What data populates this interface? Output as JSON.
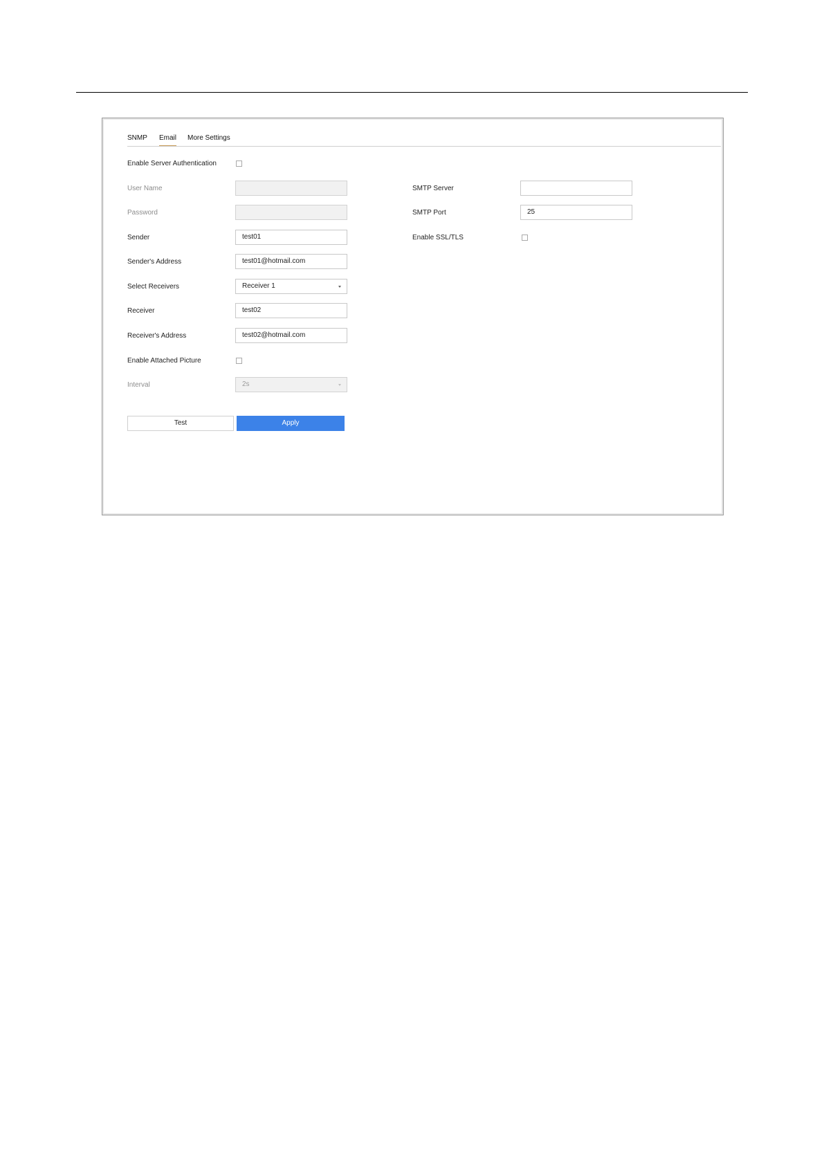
{
  "tabs": [
    {
      "label": "SNMP",
      "active": false
    },
    {
      "label": "Email",
      "active": true
    },
    {
      "label": "More Settings",
      "active": false
    }
  ],
  "form": {
    "enable_server_auth": {
      "label": "Enable Server Authentication",
      "checked": false
    },
    "user_name": {
      "label": "User Name",
      "value": "",
      "disabled": true
    },
    "password": {
      "label": "Password",
      "value": "",
      "disabled": true
    },
    "sender": {
      "label": "Sender",
      "value": "test01"
    },
    "sender_address": {
      "label": "Sender's Address",
      "value": "test01@hotmail.com"
    },
    "select_receivers": {
      "label": "Select Receivers",
      "value": "Receiver 1"
    },
    "receiver": {
      "label": "Receiver",
      "value": "test02"
    },
    "receiver_address": {
      "label": "Receiver's Address",
      "value": "test02@hotmail.com"
    },
    "enable_attached_picture": {
      "label": "Enable Attached Picture",
      "checked": false
    },
    "interval": {
      "label": "Interval",
      "value": "2s",
      "disabled": true
    },
    "smtp_server": {
      "label": "SMTP Server",
      "value": ""
    },
    "smtp_port": {
      "label": "SMTP Port",
      "value": "25"
    },
    "enable_ssl_tls": {
      "label": "Enable SSL/TLS",
      "checked": false
    }
  },
  "buttons": {
    "test_label": "Test",
    "apply_label": "Apply"
  },
  "colors": {
    "accent": "#3c82e8",
    "tab_underline": "#c89a55"
  }
}
